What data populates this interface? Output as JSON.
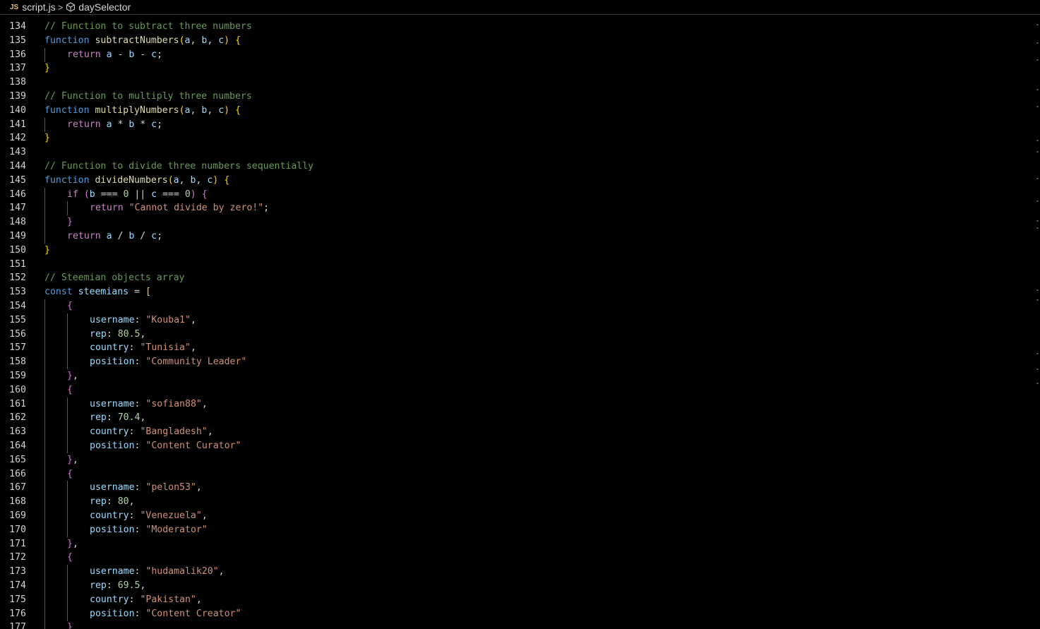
{
  "breadcrumb": {
    "lang_badge": "JS",
    "file": "script.js",
    "separator": ">",
    "symbol": "daySelector",
    "symbol_icon": "cube-icon"
  },
  "editor": {
    "lines": [
      {
        "n": "134",
        "indent": 0,
        "tokens": [
          {
            "c": "cm",
            "t": "// Function to subtract three numbers"
          }
        ]
      },
      {
        "n": "135",
        "indent": 0,
        "tokens": [
          {
            "c": "kw",
            "t": "function"
          },
          {
            "c": "op",
            "t": " "
          },
          {
            "c": "fn",
            "t": "subtractNumbers"
          },
          {
            "c": "b1",
            "t": "("
          },
          {
            "c": "pm",
            "t": "a"
          },
          {
            "c": "op",
            "t": ", "
          },
          {
            "c": "pm",
            "t": "b"
          },
          {
            "c": "op",
            "t": ", "
          },
          {
            "c": "pm",
            "t": "c"
          },
          {
            "c": "b1",
            "t": ")"
          },
          {
            "c": "op",
            "t": " "
          },
          {
            "c": "b1",
            "t": "{"
          }
        ]
      },
      {
        "n": "136",
        "indent": 1,
        "tokens": [
          {
            "c": "ctl",
            "t": "return"
          },
          {
            "c": "op",
            "t": " "
          },
          {
            "c": "pm",
            "t": "a"
          },
          {
            "c": "op",
            "t": " - "
          },
          {
            "c": "pm",
            "t": "b"
          },
          {
            "c": "op",
            "t": " - "
          },
          {
            "c": "pm",
            "t": "c"
          },
          {
            "c": "op",
            "t": ";"
          }
        ]
      },
      {
        "n": "137",
        "indent": 0,
        "tokens": [
          {
            "c": "b1",
            "t": "}"
          }
        ]
      },
      {
        "n": "138",
        "indent": 0,
        "tokens": []
      },
      {
        "n": "139",
        "indent": 0,
        "tokens": [
          {
            "c": "cm",
            "t": "// Function to multiply three numbers"
          }
        ]
      },
      {
        "n": "140",
        "indent": 0,
        "tokens": [
          {
            "c": "kw",
            "t": "function"
          },
          {
            "c": "op",
            "t": " "
          },
          {
            "c": "fn",
            "t": "multiplyNumbers"
          },
          {
            "c": "b1",
            "t": "("
          },
          {
            "c": "pm",
            "t": "a"
          },
          {
            "c": "op",
            "t": ", "
          },
          {
            "c": "pm",
            "t": "b"
          },
          {
            "c": "op",
            "t": ", "
          },
          {
            "c": "pm",
            "t": "c"
          },
          {
            "c": "b1",
            "t": ")"
          },
          {
            "c": "op",
            "t": " "
          },
          {
            "c": "b1",
            "t": "{"
          }
        ]
      },
      {
        "n": "141",
        "indent": 1,
        "tokens": [
          {
            "c": "ctl",
            "t": "return"
          },
          {
            "c": "op",
            "t": " "
          },
          {
            "c": "pm",
            "t": "a"
          },
          {
            "c": "op",
            "t": " * "
          },
          {
            "c": "pm",
            "t": "b"
          },
          {
            "c": "op",
            "t": " * "
          },
          {
            "c": "pm",
            "t": "c"
          },
          {
            "c": "op",
            "t": ";"
          }
        ]
      },
      {
        "n": "142",
        "indent": 0,
        "tokens": [
          {
            "c": "b1",
            "t": "}"
          }
        ]
      },
      {
        "n": "143",
        "indent": 0,
        "tokens": []
      },
      {
        "n": "144",
        "indent": 0,
        "tokens": [
          {
            "c": "cm",
            "t": "// Function to divide three numbers sequentially"
          }
        ]
      },
      {
        "n": "145",
        "indent": 0,
        "tokens": [
          {
            "c": "kw",
            "t": "function"
          },
          {
            "c": "op",
            "t": " "
          },
          {
            "c": "fn",
            "t": "divideNumbers"
          },
          {
            "c": "b1",
            "t": "("
          },
          {
            "c": "pm",
            "t": "a"
          },
          {
            "c": "op",
            "t": ", "
          },
          {
            "c": "pm",
            "t": "b"
          },
          {
            "c": "op",
            "t": ", "
          },
          {
            "c": "pm",
            "t": "c"
          },
          {
            "c": "b1",
            "t": ")"
          },
          {
            "c": "op",
            "t": " "
          },
          {
            "c": "b1",
            "t": "{"
          }
        ]
      },
      {
        "n": "146",
        "indent": 1,
        "tokens": [
          {
            "c": "ctl",
            "t": "if"
          },
          {
            "c": "op",
            "t": " "
          },
          {
            "c": "b2",
            "t": "("
          },
          {
            "c": "pm",
            "t": "b"
          },
          {
            "c": "op",
            "t": " === "
          },
          {
            "c": "num",
            "t": "0"
          },
          {
            "c": "op",
            "t": " || "
          },
          {
            "c": "pm",
            "t": "c"
          },
          {
            "c": "op",
            "t": " === "
          },
          {
            "c": "num",
            "t": "0"
          },
          {
            "c": "b2",
            "t": ")"
          },
          {
            "c": "op",
            "t": " "
          },
          {
            "c": "b2",
            "t": "{"
          }
        ]
      },
      {
        "n": "147",
        "indent": 2,
        "tokens": [
          {
            "c": "ctl",
            "t": "return"
          },
          {
            "c": "op",
            "t": " "
          },
          {
            "c": "str",
            "t": "\"Cannot divide by zero!\""
          },
          {
            "c": "op",
            "t": ";"
          }
        ]
      },
      {
        "n": "148",
        "indent": 1,
        "tokens": [
          {
            "c": "b2",
            "t": "}"
          }
        ]
      },
      {
        "n": "149",
        "indent": 1,
        "tokens": [
          {
            "c": "ctl",
            "t": "return"
          },
          {
            "c": "op",
            "t": " "
          },
          {
            "c": "pm",
            "t": "a"
          },
          {
            "c": "op",
            "t": " / "
          },
          {
            "c": "pm",
            "t": "b"
          },
          {
            "c": "op",
            "t": " / "
          },
          {
            "c": "pm",
            "t": "c"
          },
          {
            "c": "op",
            "t": ";"
          }
        ]
      },
      {
        "n": "150",
        "indent": 0,
        "tokens": [
          {
            "c": "b1",
            "t": "}"
          }
        ]
      },
      {
        "n": "151",
        "indent": 0,
        "tokens": []
      },
      {
        "n": "152",
        "indent": 0,
        "tokens": [
          {
            "c": "cm",
            "t": "// Steemian objects array"
          }
        ]
      },
      {
        "n": "153",
        "indent": 0,
        "tokens": [
          {
            "c": "kw",
            "t": "const"
          },
          {
            "c": "op",
            "t": " "
          },
          {
            "c": "vr",
            "t": "steemians"
          },
          {
            "c": "op",
            "t": " = "
          },
          {
            "c": "b1",
            "t": "["
          }
        ]
      },
      {
        "n": "154",
        "indent": 1,
        "tokens": [
          {
            "c": "b2",
            "t": "{"
          }
        ]
      },
      {
        "n": "155",
        "indent": 2,
        "tokens": [
          {
            "c": "prop",
            "t": "username"
          },
          {
            "c": "op",
            "t": ": "
          },
          {
            "c": "str",
            "t": "\"Kouba1\""
          },
          {
            "c": "op",
            "t": ","
          }
        ]
      },
      {
        "n": "156",
        "indent": 2,
        "tokens": [
          {
            "c": "prop",
            "t": "rep"
          },
          {
            "c": "op",
            "t": ": "
          },
          {
            "c": "num",
            "t": "80.5"
          },
          {
            "c": "op",
            "t": ","
          }
        ]
      },
      {
        "n": "157",
        "indent": 2,
        "tokens": [
          {
            "c": "prop",
            "t": "country"
          },
          {
            "c": "op",
            "t": ": "
          },
          {
            "c": "str",
            "t": "\"Tunisia\""
          },
          {
            "c": "op",
            "t": ","
          }
        ]
      },
      {
        "n": "158",
        "indent": 2,
        "tokens": [
          {
            "c": "prop",
            "t": "position"
          },
          {
            "c": "op",
            "t": ": "
          },
          {
            "c": "str",
            "t": "\"Community Leader\""
          }
        ]
      },
      {
        "n": "159",
        "indent": 1,
        "tokens": [
          {
            "c": "b2",
            "t": "}"
          },
          {
            "c": "op",
            "t": ","
          }
        ]
      },
      {
        "n": "160",
        "indent": 1,
        "tokens": [
          {
            "c": "b2",
            "t": "{"
          }
        ]
      },
      {
        "n": "161",
        "indent": 2,
        "tokens": [
          {
            "c": "prop",
            "t": "username"
          },
          {
            "c": "op",
            "t": ": "
          },
          {
            "c": "str",
            "t": "\"sofian88\""
          },
          {
            "c": "op",
            "t": ","
          }
        ]
      },
      {
        "n": "162",
        "indent": 2,
        "tokens": [
          {
            "c": "prop",
            "t": "rep"
          },
          {
            "c": "op",
            "t": ": "
          },
          {
            "c": "num",
            "t": "70.4"
          },
          {
            "c": "op",
            "t": ","
          }
        ]
      },
      {
        "n": "163",
        "indent": 2,
        "tokens": [
          {
            "c": "prop",
            "t": "country"
          },
          {
            "c": "op",
            "t": ": "
          },
          {
            "c": "str",
            "t": "\"Bangladesh\""
          },
          {
            "c": "op",
            "t": ","
          }
        ]
      },
      {
        "n": "164",
        "indent": 2,
        "tokens": [
          {
            "c": "prop",
            "t": "position"
          },
          {
            "c": "op",
            "t": ": "
          },
          {
            "c": "str",
            "t": "\"Content Curator\""
          }
        ]
      },
      {
        "n": "165",
        "indent": 1,
        "tokens": [
          {
            "c": "b2",
            "t": "}"
          },
          {
            "c": "op",
            "t": ","
          }
        ]
      },
      {
        "n": "166",
        "indent": 1,
        "tokens": [
          {
            "c": "b2",
            "t": "{"
          }
        ]
      },
      {
        "n": "167",
        "indent": 2,
        "tokens": [
          {
            "c": "prop",
            "t": "username"
          },
          {
            "c": "op",
            "t": ": "
          },
          {
            "c": "str",
            "t": "\"pelon53\""
          },
          {
            "c": "op",
            "t": ","
          }
        ]
      },
      {
        "n": "168",
        "indent": 2,
        "tokens": [
          {
            "c": "prop",
            "t": "rep"
          },
          {
            "c": "op",
            "t": ": "
          },
          {
            "c": "num",
            "t": "80"
          },
          {
            "c": "op",
            "t": ","
          }
        ]
      },
      {
        "n": "169",
        "indent": 2,
        "tokens": [
          {
            "c": "prop",
            "t": "country"
          },
          {
            "c": "op",
            "t": ": "
          },
          {
            "c": "str",
            "t": "\"Venezuela\""
          },
          {
            "c": "op",
            "t": ","
          }
        ]
      },
      {
        "n": "170",
        "indent": 2,
        "tokens": [
          {
            "c": "prop",
            "t": "position"
          },
          {
            "c": "op",
            "t": ": "
          },
          {
            "c": "str",
            "t": "\"Moderator\""
          }
        ]
      },
      {
        "n": "171",
        "indent": 1,
        "tokens": [
          {
            "c": "b2",
            "t": "}"
          },
          {
            "c": "op",
            "t": ","
          }
        ]
      },
      {
        "n": "172",
        "indent": 1,
        "tokens": [
          {
            "c": "b2",
            "t": "{"
          }
        ]
      },
      {
        "n": "173",
        "indent": 2,
        "tokens": [
          {
            "c": "prop",
            "t": "username"
          },
          {
            "c": "op",
            "t": ": "
          },
          {
            "c": "str",
            "t": "\"hudamalik20\""
          },
          {
            "c": "op",
            "t": ","
          }
        ]
      },
      {
        "n": "174",
        "indent": 2,
        "tokens": [
          {
            "c": "prop",
            "t": "rep"
          },
          {
            "c": "op",
            "t": ": "
          },
          {
            "c": "num",
            "t": "69.5"
          },
          {
            "c": "op",
            "t": ","
          }
        ]
      },
      {
        "n": "175",
        "indent": 2,
        "tokens": [
          {
            "c": "prop",
            "t": "country"
          },
          {
            "c": "op",
            "t": ": "
          },
          {
            "c": "str",
            "t": "\"Pakistan\""
          },
          {
            "c": "op",
            "t": ","
          }
        ]
      },
      {
        "n": "176",
        "indent": 2,
        "tokens": [
          {
            "c": "prop",
            "t": "position"
          },
          {
            "c": "op",
            "t": ": "
          },
          {
            "c": "str",
            "t": "\"Content Creator\""
          }
        ]
      },
      {
        "n": "177",
        "indent": 1,
        "tokens": [
          {
            "c": "b2",
            "t": "}"
          }
        ]
      }
    ]
  },
  "colors": {
    "background": "#000000",
    "keyword": "#569cd6",
    "control": "#c586c0",
    "function": "#dcdcaa",
    "parameter": "#9cdcfe",
    "string": "#ce9178",
    "number": "#b5cea8",
    "comment": "#6a9955",
    "bracket_level1": "#ffd700",
    "bracket_level2": "#da70d6"
  }
}
